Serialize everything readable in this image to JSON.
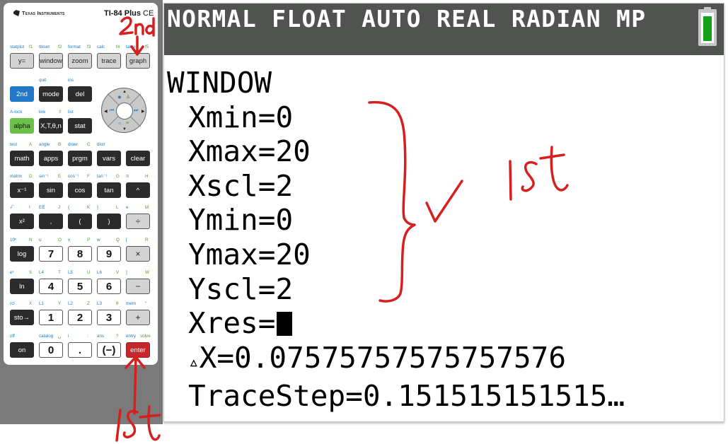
{
  "calculator": {
    "brand": "Texas Instruments",
    "model": "TI-84 Plus",
    "model_suffix": "CE",
    "rows": [
      {
        "keys": [
          {
            "label": "y=",
            "style": "gray",
            "second": "statplot",
            "alpha": "f1"
          },
          {
            "label": "window",
            "style": "gray",
            "second": "tblset",
            "alpha": "f2"
          },
          {
            "label": "zoom",
            "style": "gray",
            "second": "format",
            "alpha": "f3"
          },
          {
            "label": "trace",
            "style": "gray",
            "second": "calc",
            "alpha": "f4"
          },
          {
            "label": "graph",
            "style": "gray",
            "second": "table",
            "alpha": "f5"
          }
        ]
      },
      {
        "keys": [
          {
            "label": "2nd",
            "style": "blue",
            "second": "",
            "alpha": ""
          },
          {
            "label": "mode",
            "style": "dark",
            "second": "quit",
            "alpha": ""
          },
          {
            "label": "del",
            "style": "dark",
            "second": "ins",
            "alpha": ""
          }
        ]
      },
      {
        "keys": [
          {
            "label": "alpha",
            "style": "green",
            "second": "A-lock",
            "alpha": ""
          },
          {
            "label": "X,T,θ,n",
            "style": "dark",
            "second": "link",
            "alpha": "⇳"
          },
          {
            "label": "stat",
            "style": "dark",
            "second": "list",
            "alpha": ""
          }
        ]
      },
      {
        "keys": [
          {
            "label": "math",
            "style": "dark",
            "second": "test",
            "alpha": "A"
          },
          {
            "label": "apps",
            "style": "dark",
            "second": "angle",
            "alpha": "B"
          },
          {
            "label": "prgm",
            "style": "dark",
            "second": "draw",
            "alpha": "C"
          },
          {
            "label": "vars",
            "style": "dark",
            "second": "distr",
            "alpha": ""
          },
          {
            "label": "clear",
            "style": "dark",
            "second": "",
            "alpha": ""
          }
        ]
      },
      {
        "keys": [
          {
            "label": "x⁻¹",
            "style": "dark",
            "second": "matrix",
            "alpha": "D"
          },
          {
            "label": "sin",
            "style": "dark",
            "second": "sin⁻¹",
            "alpha": "E"
          },
          {
            "label": "cos",
            "style": "dark",
            "second": "cos⁻¹",
            "alpha": "F"
          },
          {
            "label": "tan",
            "style": "dark",
            "second": "tan⁻¹",
            "alpha": "G"
          },
          {
            "label": "^",
            "style": "dark",
            "second": "π",
            "alpha": "H"
          }
        ]
      },
      {
        "keys": [
          {
            "label": "x²",
            "style": "dark",
            "second": "√‾",
            "alpha": "I"
          },
          {
            "label": ",",
            "style": "dark",
            "second": "EE",
            "alpha": "J"
          },
          {
            "label": "(",
            "style": "dark",
            "second": "{",
            "alpha": "K"
          },
          {
            "label": ")",
            "style": "dark",
            "second": "}",
            "alpha": "L"
          },
          {
            "label": "÷",
            "style": "op",
            "second": "e",
            "alpha": "M"
          }
        ]
      },
      {
        "keys": [
          {
            "label": "log",
            "style": "dark",
            "second": "10ˣ",
            "alpha": "N"
          },
          {
            "label": "7",
            "style": "white",
            "second": "u",
            "alpha": "O"
          },
          {
            "label": "8",
            "style": "white",
            "second": "v",
            "alpha": "P"
          },
          {
            "label": "9",
            "style": "white",
            "second": "w",
            "alpha": "Q"
          },
          {
            "label": "×",
            "style": "op",
            "second": "[",
            "alpha": "R"
          }
        ]
      },
      {
        "keys": [
          {
            "label": "ln",
            "style": "dark",
            "second": "eˣ",
            "alpha": "S"
          },
          {
            "label": "4",
            "style": "white",
            "second": "L4",
            "alpha": "T"
          },
          {
            "label": "5",
            "style": "white",
            "second": "L5",
            "alpha": "U"
          },
          {
            "label": "6",
            "style": "white",
            "second": "L6",
            "alpha": "V"
          },
          {
            "label": "−",
            "style": "op",
            "second": "]",
            "alpha": "W"
          }
        ]
      },
      {
        "keys": [
          {
            "label": "sto→",
            "style": "dark",
            "second": "rcl",
            "alpha": "X"
          },
          {
            "label": "1",
            "style": "white",
            "second": "L1",
            "alpha": "Y"
          },
          {
            "label": "2",
            "style": "white",
            "second": "L2",
            "alpha": "Z"
          },
          {
            "label": "3",
            "style": "white",
            "second": "L3",
            "alpha": "θ"
          },
          {
            "label": "+",
            "style": "op",
            "second": "mem",
            "alpha": "“"
          }
        ]
      },
      {
        "keys": [
          {
            "label": "on",
            "style": "dark",
            "second": "off",
            "alpha": ""
          },
          {
            "label": "0",
            "style": "white",
            "second": "catalog",
            "alpha": "␣"
          },
          {
            "label": ".",
            "style": "white",
            "second": "i",
            "alpha": ":"
          },
          {
            "label": "(−)",
            "style": "white",
            "second": "ans",
            "alpha": "?"
          },
          {
            "label": "enter",
            "style": "red",
            "second": "entry",
            "alpha": "solve"
          }
        ]
      }
    ],
    "dpad": {
      "up": "▲",
      "down": "▼",
      "left": "◀",
      "right": "▶"
    }
  },
  "screen": {
    "status": "NORMAL FLOAT AUTO REAL RADIAN MP",
    "battery_level": "full",
    "battery_color": "#16a11a",
    "title": "WINDOW",
    "settings": [
      {
        "name": "Xmin",
        "value": "0"
      },
      {
        "name": "Xmax",
        "value": "20"
      },
      {
        "name": "Xscl",
        "value": "2"
      },
      {
        "name": "Ymin",
        "value": "0"
      },
      {
        "name": "Ymax",
        "value": "20"
      },
      {
        "name": "Yscl",
        "value": "2"
      },
      {
        "name": "Xres",
        "value": ""
      }
    ],
    "delta_x": {
      "name": "ΔX",
      "value": "0.07575757575757576"
    },
    "trace_step": {
      "name": "TraceStep",
      "value": "0.151515151515…"
    }
  },
  "annotations": {
    "color": "#d62020",
    "second_label": "2nd",
    "first_label_screen": "1st",
    "first_label_enter": "1st",
    "checkmark": "✓"
  }
}
